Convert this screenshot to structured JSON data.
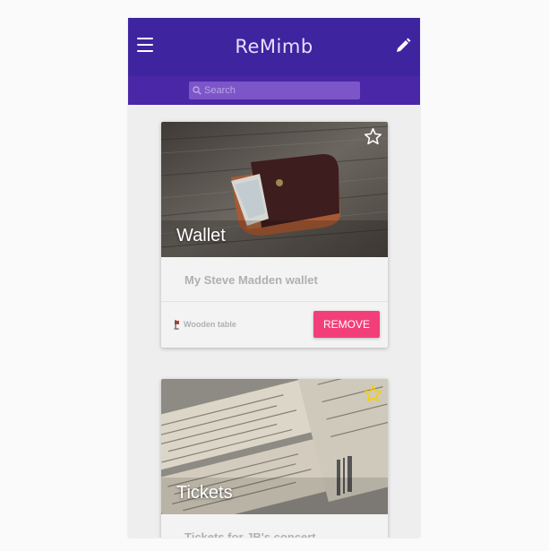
{
  "app": {
    "title": "ReMimb",
    "accent_color": "#3f24a0",
    "menu_icon": "hamburger-menu-icon",
    "edit_icon": "pencil-icon"
  },
  "search": {
    "placeholder": "Search",
    "icon": "search-icon"
  },
  "cards": [
    {
      "title": "Wallet",
      "description": "My Steve Madden wallet",
      "location": "Wooden table",
      "location_icon": "location-pin-icon",
      "action_label": "REMOVE",
      "starred": false,
      "image": "leather wallet on wooden table"
    },
    {
      "title": "Tickets",
      "description": "Tickets for JB's concert",
      "starred": true,
      "star_color": "#f5d000",
      "image": "concert tickets"
    }
  ],
  "colors": {
    "remove_button": "#f23f7a",
    "background": "#eeeeee"
  }
}
